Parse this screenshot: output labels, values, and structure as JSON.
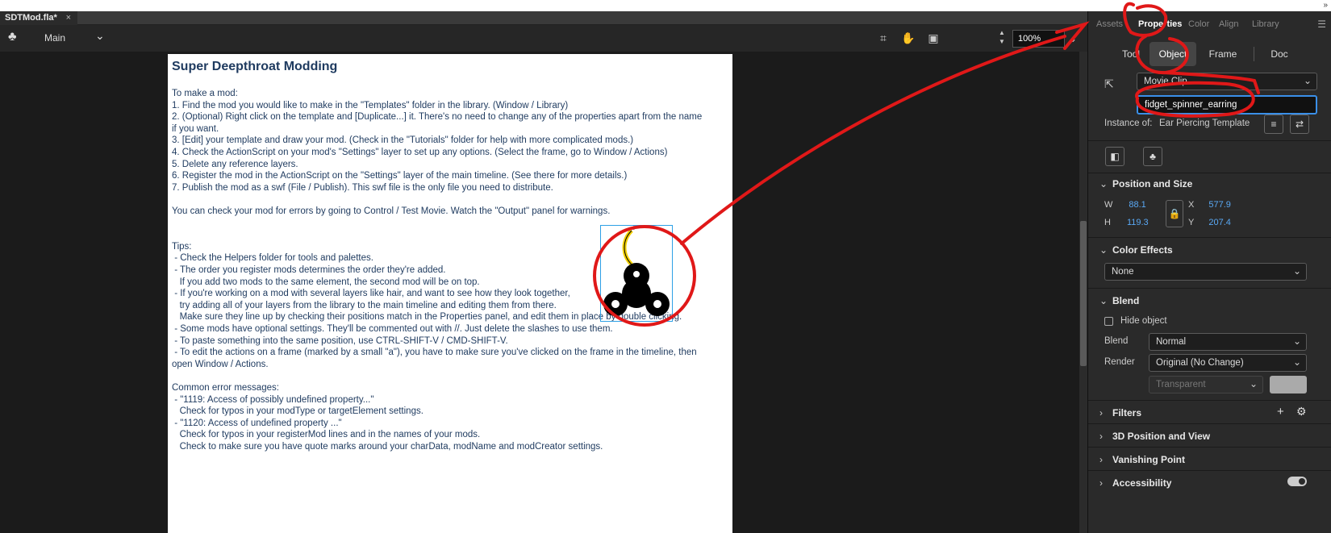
{
  "document": {
    "tab_title": "SDTMod.fla*",
    "close_glyph": "×"
  },
  "toolbar": {
    "scene": "Main",
    "zoom": "100%"
  },
  "stage": {
    "title": "Super Deepthroat Modding",
    "lines": [
      "To make a mod:",
      "1. Find the mod you would like to make in the \"Templates\" folder in the library. (Window / Library)",
      "2. (Optional) Right click on the template and [Duplicate...] it. There's no need to change any of the properties apart from the name",
      "if you want.",
      "3. [Edit] your template and draw your mod. (Check in the \"Tutorials\" folder for help with more complicated mods.)",
      "4. Check the ActionScript on your mod's \"Settings\" layer to set up any options. (Select the frame, go to Window / Actions)",
      "5. Delete any reference layers.",
      "6. Register the mod in the ActionScript on the \"Settings\" layer of the main timeline. (See there for more details.)",
      "7. Publish the mod as a swf (File / Publish). This swf file is the only file you need to distribute.",
      "",
      "You can check your mod for errors by going to Control / Test Movie. Watch the \"Output\" panel for warnings.",
      "",
      "",
      "Tips:",
      " - Check the Helpers folder for tools and palettes.",
      " - The order you register mods determines the order they're added.",
      "   If you add two mods to the same element, the second mod will be on top.",
      " - If you're working on a mod with several layers like hair, and want to see how they look together,",
      "   try adding all of your layers from the library to the main timeline and editing them from there.",
      "   Make sure they line up by checking their positions match in the Properties panel, and edit them in place by double clicking.",
      " - Some mods have optional settings. They'll be commented out with //. Just delete the slashes to use them.",
      " - To paste something into the same position, use CTRL-SHIFT-V / CMD-SHIFT-V.",
      " - To edit the actions on a frame (marked by a small \"a\"), you have to make sure you've clicked on the frame in the timeline, then",
      "open Window / Actions.",
      "",
      "Common error messages:",
      " - \"1119: Access of possibly undefined property...\"",
      "   Check for typos in your modType or targetElement settings.",
      " - \"1120: Access of undefined property ...\"",
      "   Check for typos in your registerMod lines and in the names of your mods.",
      "   Check to make sure you have quote marks around your charData, modName and modCreator settings."
    ]
  },
  "panel": {
    "tabs": [
      "Assets",
      "Properties",
      "Color",
      "Align",
      "Library"
    ],
    "subtabs": [
      "Tool",
      "Object",
      "Frame",
      "Doc"
    ],
    "symbol_type": "Movie Clip",
    "instance_name": "fidget_spinner_earring",
    "instance_of_label": "Instance of:",
    "instance_of_value": "Ear Piercing Template",
    "position_size": {
      "title": "Position and Size",
      "w_label": "W",
      "w": "88.1",
      "h_label": "H",
      "h": "119.3",
      "x_label": "X",
      "x": "577.9",
      "y_label": "Y",
      "y": "207.4"
    },
    "color_effects": {
      "title": "Color Effects",
      "value": "None"
    },
    "blend": {
      "title": "Blend",
      "hide_object": "Hide object",
      "blend_label": "Blend",
      "blend_value": "Normal",
      "render_label": "Render",
      "render_value": "Original (No Change)",
      "transparent": "Transparent"
    },
    "filters": "Filters",
    "three_d": "3D Position and View",
    "vanishing": "Vanishing Point",
    "accessibility": "Accessibility"
  },
  "colors": {
    "accent": "#3a8fe8",
    "annotation": "#e01818",
    "value_blue": "#5aa9f5"
  }
}
